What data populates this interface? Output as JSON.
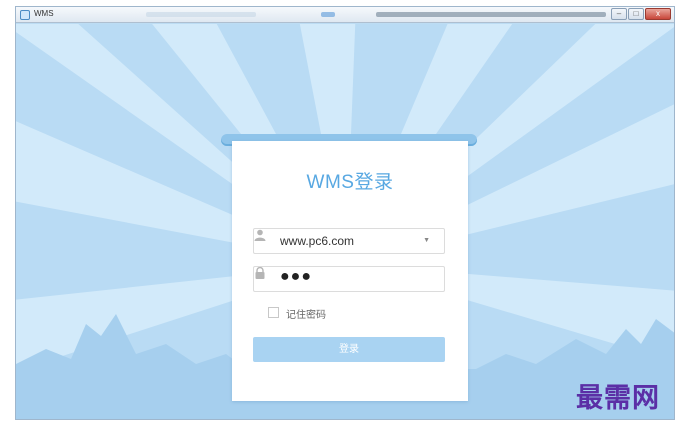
{
  "window": {
    "title": "WMS",
    "controls": {
      "minimize": "–",
      "maximize": "□",
      "close": "x"
    }
  },
  "login": {
    "title": "WMS登录",
    "username": {
      "value": "www.pc6.com",
      "dropdown_arrow": "▼",
      "icon": "user-icon"
    },
    "password": {
      "masked_value": "●●●",
      "icon": "lock-icon"
    },
    "remember_label": "记住密码",
    "remember_checked": false,
    "submit_label": "登录"
  },
  "watermark": "最需网",
  "colors": {
    "background": "#b9dbf4",
    "ray": "#d2eafa",
    "accent": "#58a8e2",
    "button": "#a9d3f2",
    "watermark": "#5b2fa6"
  }
}
